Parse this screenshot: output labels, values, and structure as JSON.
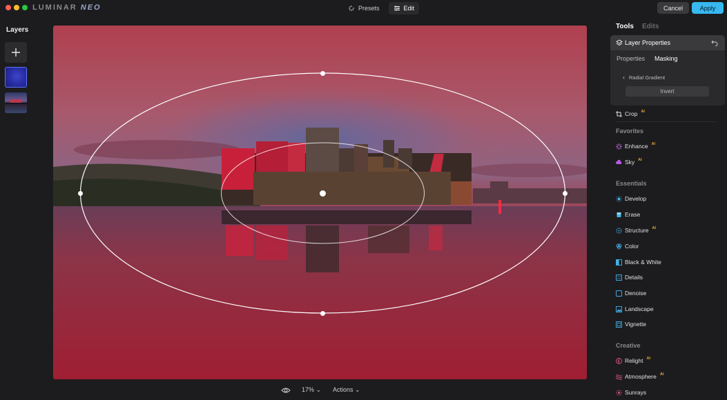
{
  "app": {
    "logo_main": "LUMINAR",
    "logo_neo": "NEO"
  },
  "topbar": {
    "modes": [
      {
        "label": "Presets",
        "icon": "presets-icon"
      },
      {
        "label": "Edit",
        "icon": "sliders-icon"
      }
    ],
    "cancel_label": "Cancel",
    "apply_label": "Apply"
  },
  "layers": {
    "title": "Layers",
    "add_icon": "plus-icon"
  },
  "bottom": {
    "zoom": "17%",
    "actions": "Actions"
  },
  "panel": {
    "tab_tools": "Tools",
    "tab_edits": "Edits",
    "layer_properties": {
      "title": "Layer Properties",
      "tabs": [
        "Properties",
        "Masking"
      ],
      "sub": "Radial Gradient",
      "invert": "Invert"
    },
    "crop": "Crop",
    "favorites": {
      "title": "Favorites",
      "items": [
        {
          "label": "Enhance",
          "ai": "AI"
        },
        {
          "label": "Sky",
          "ai": "AI"
        }
      ]
    },
    "essentials": {
      "title": "Essentials",
      "items": [
        {
          "label": "Develop"
        },
        {
          "label": "Erase"
        },
        {
          "label": "Structure",
          "ai": "AI"
        },
        {
          "label": "Color"
        },
        {
          "label": "Black & White"
        },
        {
          "label": "Details"
        },
        {
          "label": "Denoise"
        },
        {
          "label": "Landscape"
        },
        {
          "label": "Vignette"
        }
      ]
    },
    "creative": {
      "title": "Creative",
      "items": [
        {
          "label": "Relight",
          "ai": "AI"
        },
        {
          "label": "Atmosphere",
          "ai": "AI"
        },
        {
          "label": "Sunrays"
        }
      ]
    },
    "crop_ai": "AI"
  },
  "colors": {
    "accent": "#37b8f0",
    "selected_layer_border": "#5876ff",
    "ai_badge": "#e5a63a",
    "canvas_tint": "#b2303f"
  }
}
